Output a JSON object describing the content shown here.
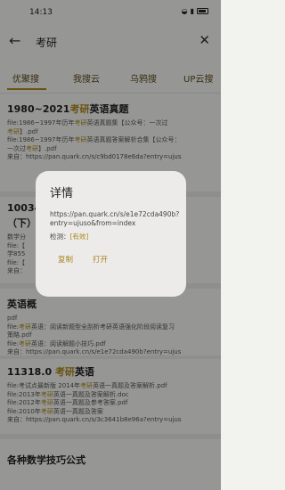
{
  "status": {
    "time": "14:13",
    "battery": "64"
  },
  "search": {
    "query": "考研"
  },
  "tabs": [
    "优聚搜",
    "我搜云",
    "乌鸦搜",
    "UP云搜"
  ],
  "cards": [
    {
      "title": [
        "1980~2021",
        "考研",
        "英语真题"
      ],
      "lines": [
        [
          "file:1986~1997年历年",
          "考研",
          "英语真题集【公众号：一次过"
        ],
        [
          "考研",
          "】.pdf"
        ],
        [
          "file:1986~1997年历年",
          "考研",
          "英语真题答案解析合集【公众号："
        ],
        [
          "一次过",
          "考研",
          "】.pdf"
        ],
        [
          "来自：https://pan.quark.cn/s/c9bd0178e6da?entry=ujus",
          ""
        ]
      ]
    },
    {
      "title": [
        "10034",
        "",
        ""
      ],
      "subtitle": "（下）",
      "lines": [
        [
          "数学分",
          "",
          ""
        ],
        [
          "file:【",
          "",
          "师范大"
        ],
        [
          "学855",
          "",
          ""
        ],
        [
          "file:【",
          "",
          ""
        ],
        [
          "来自：",
          "",
          ""
        ]
      ]
    },
    {
      "title": [
        "英语概",
        "",
        ""
      ],
      "lines": [
        [
          "pdf",
          "",
          ""
        ],
        [
          "file:",
          "考研",
          "英语：阅读新题型全刮析考研英语强化阶段阅读复习"
        ],
        [
          "策略.pdf",
          "",
          ""
        ],
        [
          "file:",
          "考研",
          "英语：阅读解题小技巧.pdf"
        ],
        [
          "来自：https://pan.quark.cn/s/e1e72cda490b?entry=ujus",
          ""
        ]
      ]
    },
    {
      "title": [
        "11318.0 ",
        "考研",
        "英语"
      ],
      "lines": [
        [
          "file:考试点最新版 2014年",
          "考研",
          "英语一真题及答案解析.pdf"
        ],
        [
          "file:2013年",
          "考研",
          "英语一真题及答案解析.doc"
        ],
        [
          "file:2012年",
          "考研",
          "英语一真题及参考答案.pdf"
        ],
        [
          "file:2010年",
          "考研",
          "英语一真题及答案"
        ],
        [
          "来自：https://pan.quark.cn/s/3c3641b8e96a?entry=ujus",
          ""
        ]
      ]
    },
    {
      "title": [
        "各种数学技巧公式",
        "",
        ""
      ],
      "lines": []
    }
  ],
  "dialog": {
    "title": "详情",
    "url": "https://pan.quark.cn/s/e1e72cda490b?entry=ujuso&from=index",
    "check_label": "检测：",
    "check_value": "[有效]",
    "copy_label": "复制",
    "open_label": "打开"
  },
  "colors": {
    "accent": "#a9861c",
    "scrim": "rgba(0,0,0,0.38)"
  }
}
